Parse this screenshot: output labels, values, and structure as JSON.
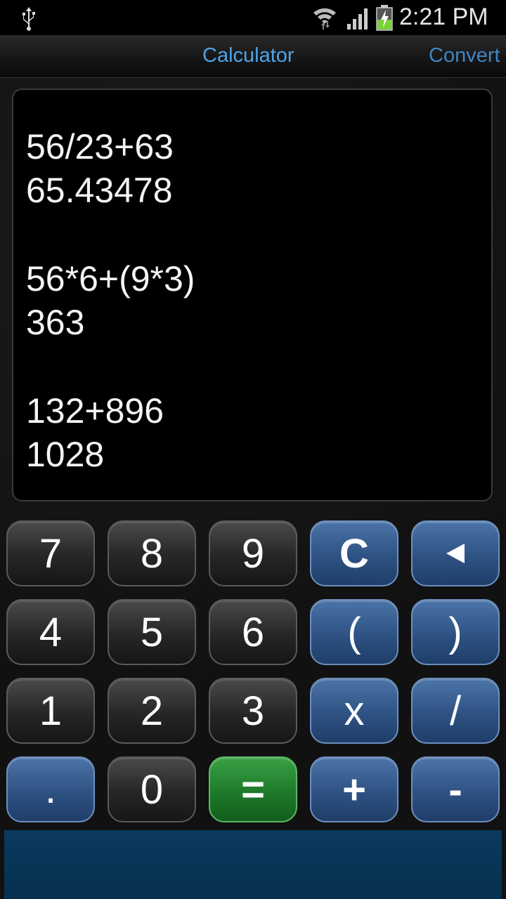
{
  "status": {
    "time": "2:21 PM",
    "icons": [
      "usb-icon",
      "wifi-icon",
      "signal-icon",
      "battery-charging-icon"
    ]
  },
  "tabs": {
    "calculator": "Calculator",
    "convert": "Convert"
  },
  "display": {
    "lines": [
      "56/23+63",
      "65.43478",
      "56*6+(9*3)",
      "363",
      "132+896",
      "1028"
    ]
  },
  "keys": {
    "seven": "7",
    "eight": "8",
    "nine": "9",
    "clear": "C",
    "four": "4",
    "five": "5",
    "six": "6",
    "open_paren": "(",
    "close_paren": ")",
    "one": "1",
    "two": "2",
    "three": "3",
    "multiply": "x",
    "divide": "/",
    "decimal": ".",
    "zero": "0",
    "equals": "=",
    "plus": "+",
    "minus": "-"
  },
  "colors": {
    "accent": "#4fa3e8",
    "key_dark": "#262626",
    "key_blue": "#2e5283",
    "key_green": "#1e7a2a"
  }
}
